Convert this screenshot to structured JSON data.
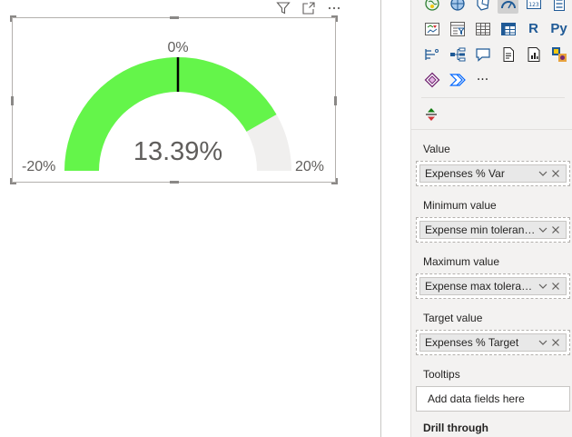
{
  "gauge": {
    "value_label": "13.39%",
    "min_label": "-20%",
    "max_label": "20%",
    "target_label": "0%",
    "value": 0.1339,
    "min": -0.2,
    "max": 0.2,
    "target": 0.0,
    "fill_color": "#64f54a",
    "track_color": "#f0efee",
    "target_color": "#000000"
  },
  "visual_header": {
    "icons": [
      "filter-icon",
      "focus-mode-icon",
      "more-options-icon"
    ]
  },
  "visualizations": {
    "rows": [
      [
        "map-icon",
        "filled-map-icon",
        "shape-map-icon",
        "gauge-icon",
        "card-icon",
        "multi-row-card-icon"
      ],
      [
        "kpi-icon",
        "slicer-icon",
        "table-icon",
        "matrix-icon",
        "r-script-icon",
        "python-icon"
      ],
      [
        "key-influencers-icon",
        "decomposition-tree-icon",
        "qa-icon",
        "paginated-report-icon",
        "smart-narrative-icon",
        "power-apps-icon"
      ],
      [
        "power-apps-diamond-icon",
        "power-automate-icon",
        "more-visuals-icon"
      ]
    ],
    "selected": "gauge-icon",
    "r_label": "R",
    "py_label": "Py",
    "more_label": "···"
  },
  "wells": {
    "value": {
      "label": "Value",
      "field": "Expenses % Var"
    },
    "min": {
      "label": "Minimum value",
      "field": "Expense min toleranc..."
    },
    "max": {
      "label": "Maximum value",
      "field": "Expense max toleranc..."
    },
    "target": {
      "label": "Target value",
      "field": "Expenses % Target"
    },
    "tooltips": {
      "label": "Tooltips",
      "placeholder": "Add data fields here"
    },
    "drill": {
      "label": "Drill through"
    }
  }
}
